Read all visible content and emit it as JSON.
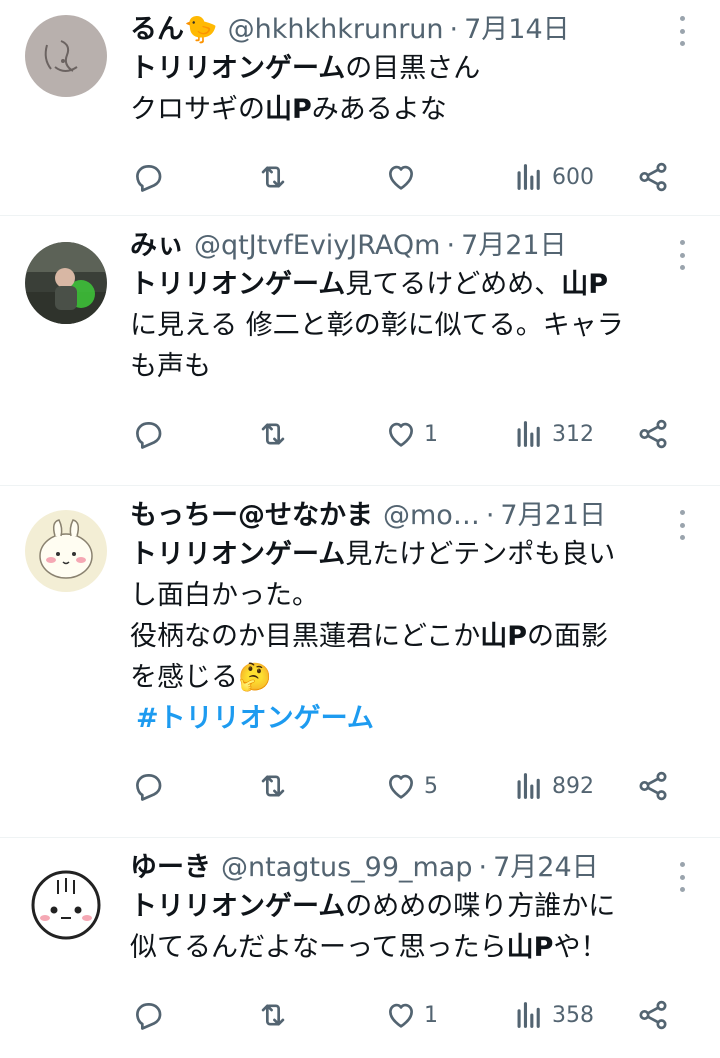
{
  "tweets": [
    {
      "name": "るん🐤",
      "handle": "@hkhkhkrunrun",
      "date": "7月14日",
      "lines": [
        [
          {
            "t": "トリリオンゲーム",
            "b": true
          },
          {
            "t": "の目黒さん"
          }
        ],
        [
          {
            "t": "クロサギの"
          },
          {
            "t": "山P",
            "b": true
          },
          {
            "t": "みあるよな"
          }
        ]
      ],
      "likes": "",
      "views": "600"
    },
    {
      "name": "みぃ",
      "handle": "@qtJtvfEviyJRAQm",
      "date": "7月21日",
      "lines": [
        [
          {
            "t": "トリリオンゲーム",
            "b": true
          },
          {
            "t": "見てるけどめめ、"
          },
          {
            "t": "山P",
            "b": true
          }
        ],
        [
          {
            "t": "に見える 修二と彰の彰に似てる。キャラ"
          }
        ],
        [
          {
            "t": "も声も"
          }
        ]
      ],
      "likes": "1",
      "views": "312"
    },
    {
      "name": "もっちー@せなかま",
      "handle": "@mo…",
      "date": "7月21日",
      "lines": [
        [
          {
            "t": "トリリオンゲーム",
            "b": true
          },
          {
            "t": "見たけどテンポも良い"
          }
        ],
        [
          {
            "t": "し面白かった。"
          }
        ],
        [
          {
            "t": "役柄なのか目黒蓮君にどこか"
          },
          {
            "t": "山P",
            "b": true
          },
          {
            "t": "の面影"
          }
        ],
        [
          {
            "t": "を感じる🤔"
          }
        ]
      ],
      "hashtag": "#トリリオンゲーム",
      "likes": "5",
      "views": "892"
    },
    {
      "name": "ゆーき",
      "handle": "@ntagtus_99_map",
      "date": "7月24日",
      "lines": [
        [
          {
            "t": "トリリオンゲーム",
            "b": true
          },
          {
            "t": "のめめの喋り方誰かに"
          }
        ],
        [
          {
            "t": "似てるんだよなーって思ったら"
          },
          {
            "t": "山P",
            "b": true
          },
          {
            "t": "や！"
          }
        ]
      ],
      "likes": "1",
      "views": "358"
    }
  ],
  "icons": {
    "reply": "reply-icon",
    "retweet": "retweet-icon",
    "like": "heart-icon",
    "views": "views-icon",
    "share": "share-icon",
    "more": "more-icon"
  },
  "colors": {
    "text": "#0f1419",
    "secondary": "#536471",
    "hashtag": "#1d9bf0",
    "divider": "#eff3f4"
  }
}
